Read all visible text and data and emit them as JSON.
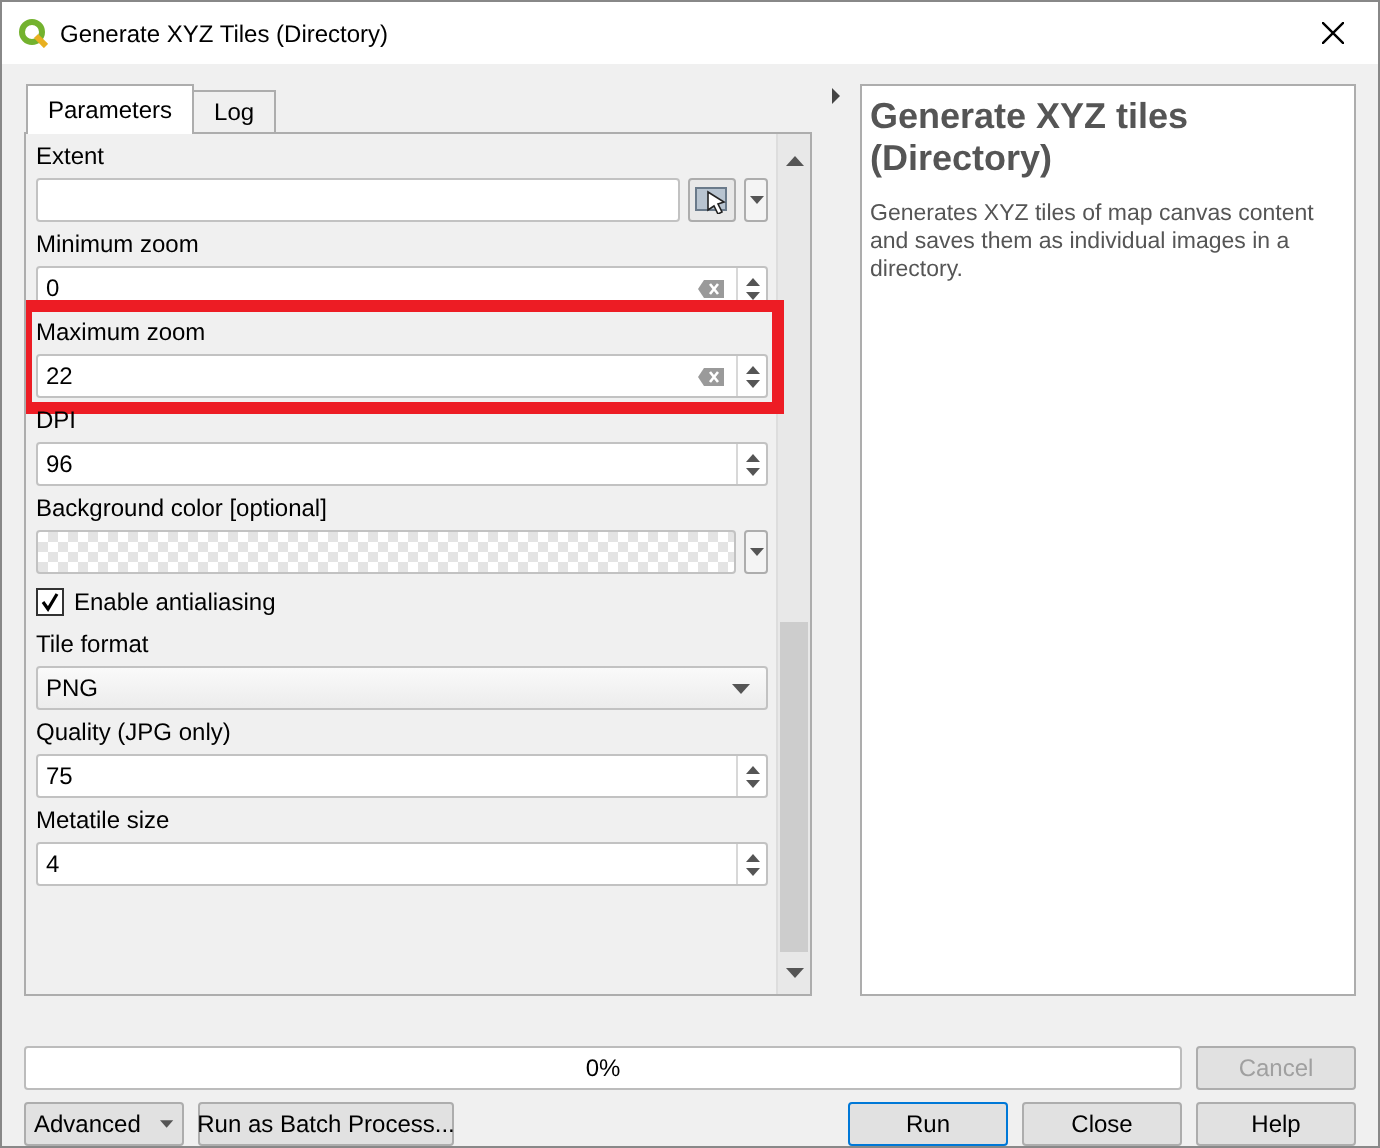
{
  "window": {
    "title": "Generate XYZ Tiles (Directory)"
  },
  "tabs": [
    {
      "label": "Parameters",
      "selected": true
    },
    {
      "label": "Log",
      "selected": false
    }
  ],
  "parameters": [
    {
      "kind": "extent",
      "label": "Extent"
    },
    {
      "kind": "spin",
      "label": "Minimum zoom",
      "value": "0",
      "clearable": true,
      "highlighted": false
    },
    {
      "kind": "spin",
      "label": "Maximum zoom",
      "value": "22",
      "clearable": true,
      "highlighted": true
    },
    {
      "kind": "spin",
      "label": "DPI",
      "value": "96",
      "clearable": false,
      "highlighted": false
    },
    {
      "kind": "color",
      "label": "Background color [optional]"
    },
    {
      "kind": "checkbox",
      "label": "Enable antialiasing",
      "checked": true
    },
    {
      "kind": "combo",
      "label": "Tile format",
      "value": "PNG"
    },
    {
      "kind": "spin",
      "label": "Quality (JPG only)",
      "value": "75",
      "clearable": false,
      "highlighted": false
    },
    {
      "kind": "spin",
      "label": "Metatile size",
      "value": "4",
      "clearable": false,
      "highlighted": false
    }
  ],
  "help": {
    "title": "Generate XYZ tiles (Directory)",
    "description": "Generates XYZ tiles of map canvas content and saves them as individual images in a directory."
  },
  "progress": {
    "level": 0,
    "reading": "0%"
  },
  "buttons": {
    "cancel": {
      "label": "Cancel",
      "disabled": true
    },
    "advanced": "Advanced",
    "batch": "Run as Batch Process...",
    "run": {
      "label": "Run",
      "default": true
    },
    "close": "Close",
    "help": "Help"
  }
}
